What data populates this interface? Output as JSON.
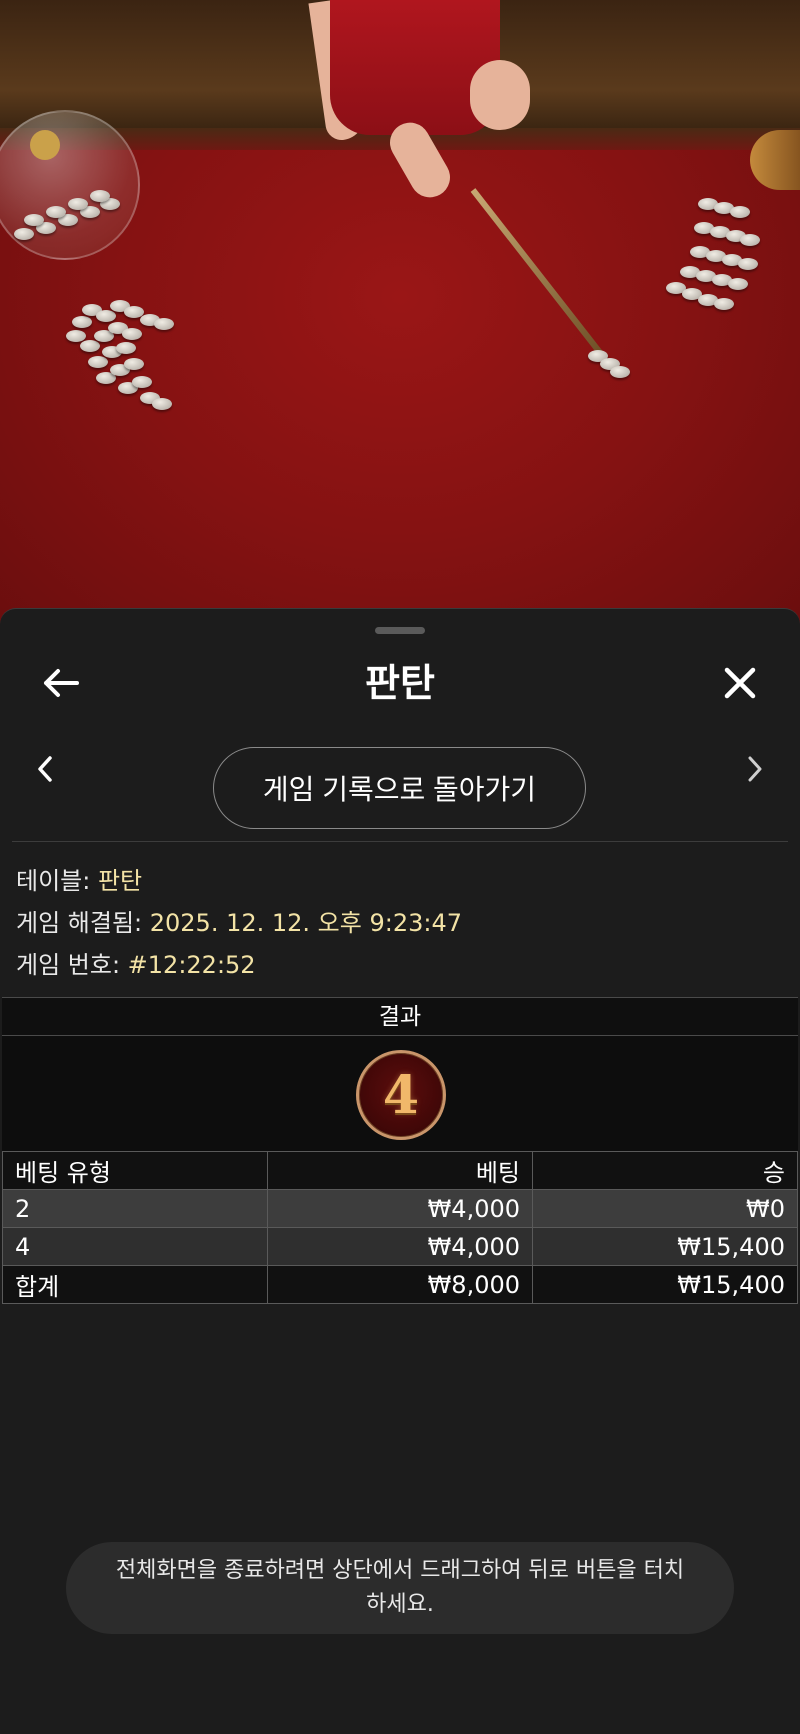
{
  "header": {
    "title": "판탄",
    "back_icon": "arrow-left-icon",
    "close_icon": "close-icon"
  },
  "navigation": {
    "prev_icon": "chevron-left-icon",
    "next_icon": "chevron-right-icon",
    "back_to_history_label": "게임 기록으로 돌아가기"
  },
  "details": {
    "table_label": "테이블: ",
    "table_value": "판탄",
    "resolved_label": "게임 해결됨: ",
    "resolved_value": "2025. 12. 12. 오후 9:23:47",
    "game_number_label": "게임 번호: ",
    "game_number_value": "#12:22:52"
  },
  "result": {
    "header": "결과",
    "value": "4"
  },
  "bets_table": {
    "columns": [
      "베팅 유형",
      "베팅",
      "승"
    ],
    "rows": [
      {
        "type": "2",
        "bet": "₩4,000",
        "win": "₩0"
      },
      {
        "type": "4",
        "bet": "₩4,000",
        "win": "₩15,400"
      }
    ],
    "total": {
      "type": "합계",
      "bet": "₩8,000",
      "win": "₩15,400"
    }
  },
  "toast": {
    "message": "전체화면을 종료하려면 상단에서 드래그하여 뒤로 버튼을 터치하세요."
  },
  "colors": {
    "accent_value": "#f3e3a6",
    "sheet_background": "#1c1c1c",
    "table_felt": "#851212"
  }
}
